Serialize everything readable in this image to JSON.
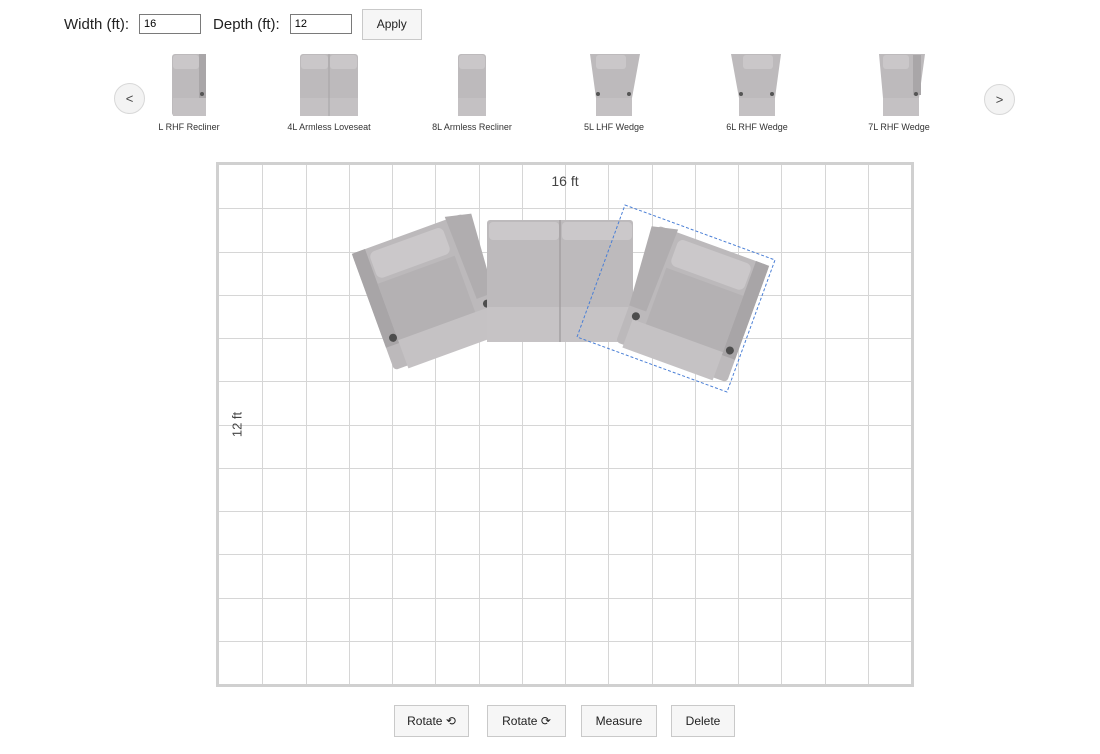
{
  "toolbar": {
    "width_label": "Width (ft):",
    "width_value": "16",
    "depth_label": "Depth (ft):",
    "depth_value": "12",
    "apply_label": "Apply"
  },
  "carousel": {
    "prev_label": "<",
    "next_label": ">",
    "items": [
      {
        "label": "L RHF Recliner",
        "icon": "recliner-rhf-icon"
      },
      {
        "label": "4L Armless Loveseat",
        "icon": "armless-loveseat-icon"
      },
      {
        "label": "8L Armless Recliner",
        "icon": "armless-recliner-icon"
      },
      {
        "label": "5L LHF Wedge",
        "icon": "wedge-lhf-icon"
      },
      {
        "label": "6L RHF Wedge",
        "icon": "wedge-rhf-icon"
      },
      {
        "label": "7L RHF Wedge",
        "icon": "wedge-rhf-icon"
      }
    ]
  },
  "room": {
    "width_label": "16 ft",
    "depth_label": "12 ft",
    "grid_cols": 16,
    "grid_rows": 12,
    "selected_piece": "right wedge recliner"
  },
  "actions": {
    "rotate_ccw": "Rotate ⟲",
    "rotate_cw": "Rotate ⟳",
    "measure": "Measure",
    "delete": "Delete"
  },
  "colors": {
    "seat": "#b8b5b7",
    "seat_dark": "#a7a4a6",
    "seat_light": "#c9c6c8",
    "grid": "#d6d6d6",
    "room_border": "#d0d0d0",
    "selection": "#4a7fd6"
  }
}
